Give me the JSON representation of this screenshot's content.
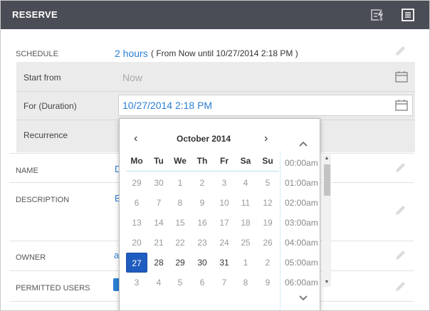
{
  "header": {
    "title": "RESERVE",
    "icons": [
      "lightning-icon",
      "list-icon"
    ]
  },
  "schedule": {
    "label": "SCHEDULE",
    "duration_link": "2 hours",
    "detail": "( From Now until 10/27/2014 2:18 PM )",
    "start_label": "Start from",
    "start_value": "Now",
    "duration_label": "For (Duration)",
    "duration_value": "10/27/2014 2:18 PM",
    "recurrence_label": "Recurrence"
  },
  "fields": {
    "name_label": "NAME",
    "name_value_partial": "D",
    "description_label": "DESCRIPTION",
    "description_value_partial": "E",
    "owner_label": "OWNER",
    "owner_value_partial": "a",
    "permitted_label": "PERMITTED USERS"
  },
  "calendar": {
    "prev": "‹",
    "next": "›",
    "month_label": "October 2014",
    "weekdays": [
      "Mo",
      "Tu",
      "We",
      "Th",
      "Fr",
      "Sa",
      "Su"
    ],
    "weeks": [
      [
        "29",
        "30",
        "1",
        "2",
        "3",
        "4",
        "5"
      ],
      [
        "6",
        "7",
        "8",
        "9",
        "10",
        "11",
        "12"
      ],
      [
        "13",
        "14",
        "15",
        "16",
        "17",
        "18",
        "19"
      ],
      [
        "20",
        "21",
        "22",
        "23",
        "24",
        "25",
        "26"
      ],
      [
        "27",
        "28",
        "29",
        "30",
        "31",
        "1",
        "2"
      ],
      [
        "3",
        "4",
        "5",
        "6",
        "7",
        "8",
        "9"
      ]
    ],
    "selected": "27",
    "times": [
      "00:00am",
      "01:00am",
      "02:00am",
      "03:00am",
      "04:00am",
      "05:00am",
      "06:00am"
    ]
  }
}
